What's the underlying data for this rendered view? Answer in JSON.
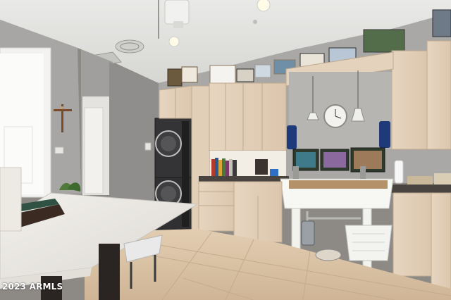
{
  "watermark": "2023 ARMLS"
}
